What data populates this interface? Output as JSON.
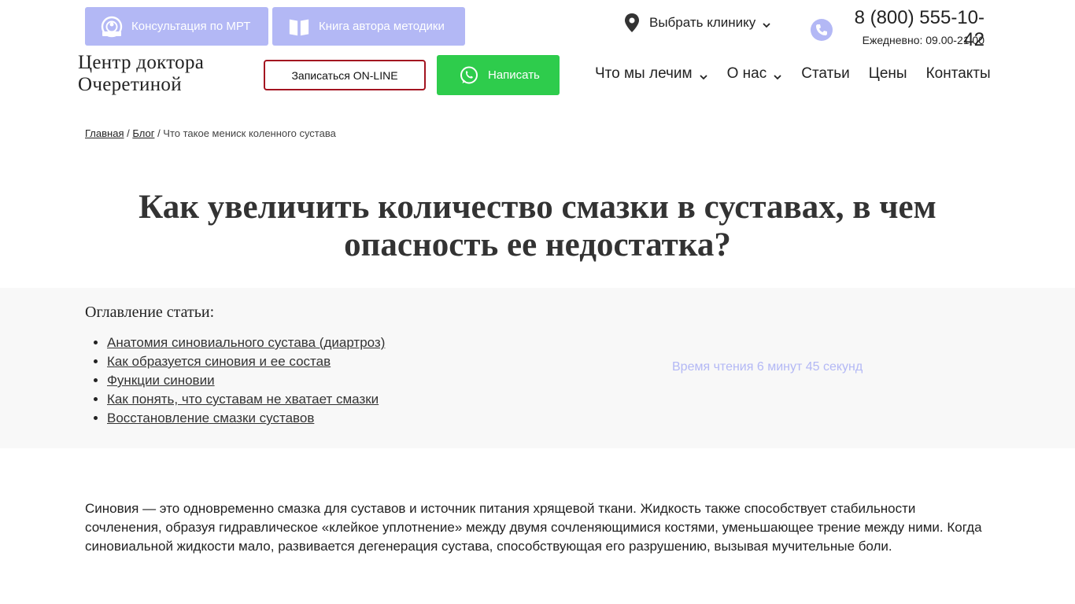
{
  "top_buttons": {
    "mri": {
      "label": "Консультация по МРТ",
      "icon": "mri-scanner-icon"
    },
    "book": {
      "label": "Книга автора методики",
      "icon": "book-icon"
    }
  },
  "clinic": {
    "label": "Выбрать клинику",
    "icon": "location-pin-icon"
  },
  "phone": {
    "number": "8 (800) 555-10-42",
    "hours": "Ежедневно: 09.00-21.00",
    "icon": "phone-icon"
  },
  "logo": {
    "line1": "Центр доктора",
    "line2": "Очеретиной"
  },
  "actions": {
    "online_label": "Записаться ON-LINE",
    "write_label": "Написать",
    "write_icon": "whatsapp-icon"
  },
  "nav": {
    "items": [
      {
        "label": "Что мы лечим",
        "dropdown": true
      },
      {
        "label": "О нас",
        "dropdown": true
      },
      {
        "label": "Статьи",
        "dropdown": false
      },
      {
        "label": "Цены",
        "dropdown": false
      },
      {
        "label": "Контакты",
        "dropdown": false
      }
    ]
  },
  "breadcrumb": {
    "home": "Главная",
    "blog": "Блог",
    "current": "Что такое мениск коленного сустава",
    "separator": "/"
  },
  "article": {
    "title": "Как увеличить количество смазки в суставах, в чем опасность ее недостатка?",
    "toc_heading": "Оглавление статьи:",
    "toc_items": [
      "Анатомия синовиального сустава (диартроз)",
      "Как образуется синовия и ее состав",
      "Функции синовии",
      "Как понять, что суставам не хватает смазки",
      "Восстановление смазки суставов"
    ],
    "read_time": "Время чтения 6 минут 45 секунд",
    "intro": "Синовия — это одновременно смазка для суставов и источник питания хрящевой ткани. Жидкость также способствует стабильности сочленения, образуя гидравлическое «клейкое уплотнение» между двумя сочленяющимися костями, уменьшающее трение между ними. Когда синовиальной жидкости мало, развивается дегенерация сустава, способствующая его разрушению, вызывая мучительные боли."
  },
  "colors": {
    "accent_lavender": "#b3b8f5",
    "whatsapp_green": "#2ecc4c",
    "online_border": "#a31420",
    "toc_bg": "#f8f8f8"
  }
}
